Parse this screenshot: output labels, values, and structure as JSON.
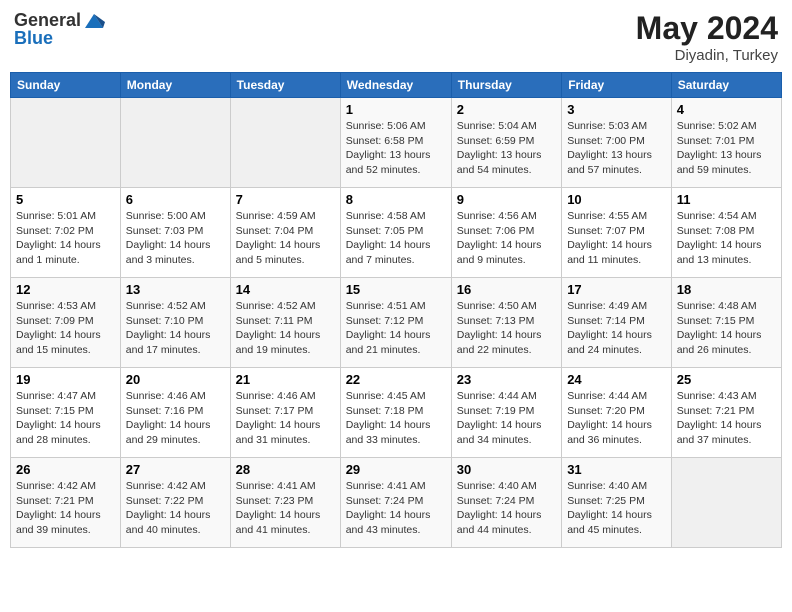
{
  "header": {
    "logo_line1": "General",
    "logo_line2": "Blue",
    "title": "May 2024",
    "location": "Diyadin, Turkey"
  },
  "weekdays": [
    "Sunday",
    "Monday",
    "Tuesday",
    "Wednesday",
    "Thursday",
    "Friday",
    "Saturday"
  ],
  "weeks": [
    [
      {
        "day": "",
        "info": ""
      },
      {
        "day": "",
        "info": ""
      },
      {
        "day": "",
        "info": ""
      },
      {
        "day": "1",
        "info": "Sunrise: 5:06 AM\nSunset: 6:58 PM\nDaylight: 13 hours and 52 minutes."
      },
      {
        "day": "2",
        "info": "Sunrise: 5:04 AM\nSunset: 6:59 PM\nDaylight: 13 hours and 54 minutes."
      },
      {
        "day": "3",
        "info": "Sunrise: 5:03 AM\nSunset: 7:00 PM\nDaylight: 13 hours and 57 minutes."
      },
      {
        "day": "4",
        "info": "Sunrise: 5:02 AM\nSunset: 7:01 PM\nDaylight: 13 hours and 59 minutes."
      }
    ],
    [
      {
        "day": "5",
        "info": "Sunrise: 5:01 AM\nSunset: 7:02 PM\nDaylight: 14 hours and 1 minute."
      },
      {
        "day": "6",
        "info": "Sunrise: 5:00 AM\nSunset: 7:03 PM\nDaylight: 14 hours and 3 minutes."
      },
      {
        "day": "7",
        "info": "Sunrise: 4:59 AM\nSunset: 7:04 PM\nDaylight: 14 hours and 5 minutes."
      },
      {
        "day": "8",
        "info": "Sunrise: 4:58 AM\nSunset: 7:05 PM\nDaylight: 14 hours and 7 minutes."
      },
      {
        "day": "9",
        "info": "Sunrise: 4:56 AM\nSunset: 7:06 PM\nDaylight: 14 hours and 9 minutes."
      },
      {
        "day": "10",
        "info": "Sunrise: 4:55 AM\nSunset: 7:07 PM\nDaylight: 14 hours and 11 minutes."
      },
      {
        "day": "11",
        "info": "Sunrise: 4:54 AM\nSunset: 7:08 PM\nDaylight: 14 hours and 13 minutes."
      }
    ],
    [
      {
        "day": "12",
        "info": "Sunrise: 4:53 AM\nSunset: 7:09 PM\nDaylight: 14 hours and 15 minutes."
      },
      {
        "day": "13",
        "info": "Sunrise: 4:52 AM\nSunset: 7:10 PM\nDaylight: 14 hours and 17 minutes."
      },
      {
        "day": "14",
        "info": "Sunrise: 4:52 AM\nSunset: 7:11 PM\nDaylight: 14 hours and 19 minutes."
      },
      {
        "day": "15",
        "info": "Sunrise: 4:51 AM\nSunset: 7:12 PM\nDaylight: 14 hours and 21 minutes."
      },
      {
        "day": "16",
        "info": "Sunrise: 4:50 AM\nSunset: 7:13 PM\nDaylight: 14 hours and 22 minutes."
      },
      {
        "day": "17",
        "info": "Sunrise: 4:49 AM\nSunset: 7:14 PM\nDaylight: 14 hours and 24 minutes."
      },
      {
        "day": "18",
        "info": "Sunrise: 4:48 AM\nSunset: 7:15 PM\nDaylight: 14 hours and 26 minutes."
      }
    ],
    [
      {
        "day": "19",
        "info": "Sunrise: 4:47 AM\nSunset: 7:15 PM\nDaylight: 14 hours and 28 minutes."
      },
      {
        "day": "20",
        "info": "Sunrise: 4:46 AM\nSunset: 7:16 PM\nDaylight: 14 hours and 29 minutes."
      },
      {
        "day": "21",
        "info": "Sunrise: 4:46 AM\nSunset: 7:17 PM\nDaylight: 14 hours and 31 minutes."
      },
      {
        "day": "22",
        "info": "Sunrise: 4:45 AM\nSunset: 7:18 PM\nDaylight: 14 hours and 33 minutes."
      },
      {
        "day": "23",
        "info": "Sunrise: 4:44 AM\nSunset: 7:19 PM\nDaylight: 14 hours and 34 minutes."
      },
      {
        "day": "24",
        "info": "Sunrise: 4:44 AM\nSunset: 7:20 PM\nDaylight: 14 hours and 36 minutes."
      },
      {
        "day": "25",
        "info": "Sunrise: 4:43 AM\nSunset: 7:21 PM\nDaylight: 14 hours and 37 minutes."
      }
    ],
    [
      {
        "day": "26",
        "info": "Sunrise: 4:42 AM\nSunset: 7:21 PM\nDaylight: 14 hours and 39 minutes."
      },
      {
        "day": "27",
        "info": "Sunrise: 4:42 AM\nSunset: 7:22 PM\nDaylight: 14 hours and 40 minutes."
      },
      {
        "day": "28",
        "info": "Sunrise: 4:41 AM\nSunset: 7:23 PM\nDaylight: 14 hours and 41 minutes."
      },
      {
        "day": "29",
        "info": "Sunrise: 4:41 AM\nSunset: 7:24 PM\nDaylight: 14 hours and 43 minutes."
      },
      {
        "day": "30",
        "info": "Sunrise: 4:40 AM\nSunset: 7:24 PM\nDaylight: 14 hours and 44 minutes."
      },
      {
        "day": "31",
        "info": "Sunrise: 4:40 AM\nSunset: 7:25 PM\nDaylight: 14 hours and 45 minutes."
      },
      {
        "day": "",
        "info": ""
      }
    ]
  ]
}
